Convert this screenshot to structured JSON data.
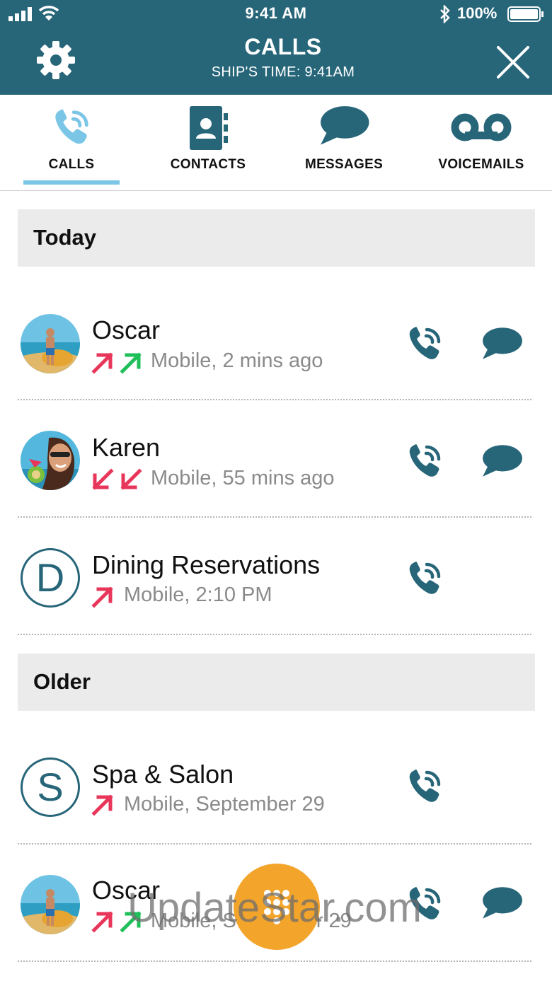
{
  "status_bar": {
    "time": "9:41 AM",
    "battery": "100%"
  },
  "header": {
    "title": "CALLS",
    "subtitle": "SHIP'S TIME: 9:41AM"
  },
  "tabs": [
    {
      "label": "CALLS",
      "icon": "phone-icon",
      "active": true
    },
    {
      "label": "CONTACTS",
      "icon": "contacts-book-icon",
      "active": false
    },
    {
      "label": "MESSAGES",
      "icon": "chat-bubble-icon",
      "active": false
    },
    {
      "label": "VOICEMAILS",
      "icon": "voicemail-icon",
      "active": false
    }
  ],
  "sections": [
    {
      "title": "Today",
      "rows": [
        {
          "name": "Oscar",
          "detail": "Mobile, 2 mins ago",
          "direction": "outgoing-incoming",
          "avatar": "photo-man",
          "message": true
        },
        {
          "name": "Karen",
          "detail": "Mobile, 55 mins ago",
          "direction": "missed-missed",
          "avatar": "photo-woman",
          "message": true
        },
        {
          "name": "Dining Reservations",
          "detail": "Mobile, 2:10 PM",
          "direction": "outgoing",
          "avatar_letter": "D",
          "message": false
        }
      ]
    },
    {
      "title": "Older",
      "rows": [
        {
          "name": "Spa & Salon",
          "detail": "Mobile, September 29",
          "direction": "outgoing",
          "avatar_letter": "S",
          "message": false
        },
        {
          "name": "Oscar",
          "detail": "Mobile, September 29",
          "direction": "outgoing-incoming",
          "avatar": "photo-man",
          "message": true
        }
      ]
    }
  ],
  "fab": {
    "icon": "dialpad-icon"
  },
  "watermark": "UpdateStar.com",
  "colors": {
    "header_bg": "#276679",
    "accent_blue": "#276679",
    "tab_underline": "#7bc6e6",
    "arrow_red": "#e8365a",
    "arrow_green": "#1fbf5a",
    "fab_orange": "#f3a42b",
    "section_bg": "#ebebeb"
  }
}
